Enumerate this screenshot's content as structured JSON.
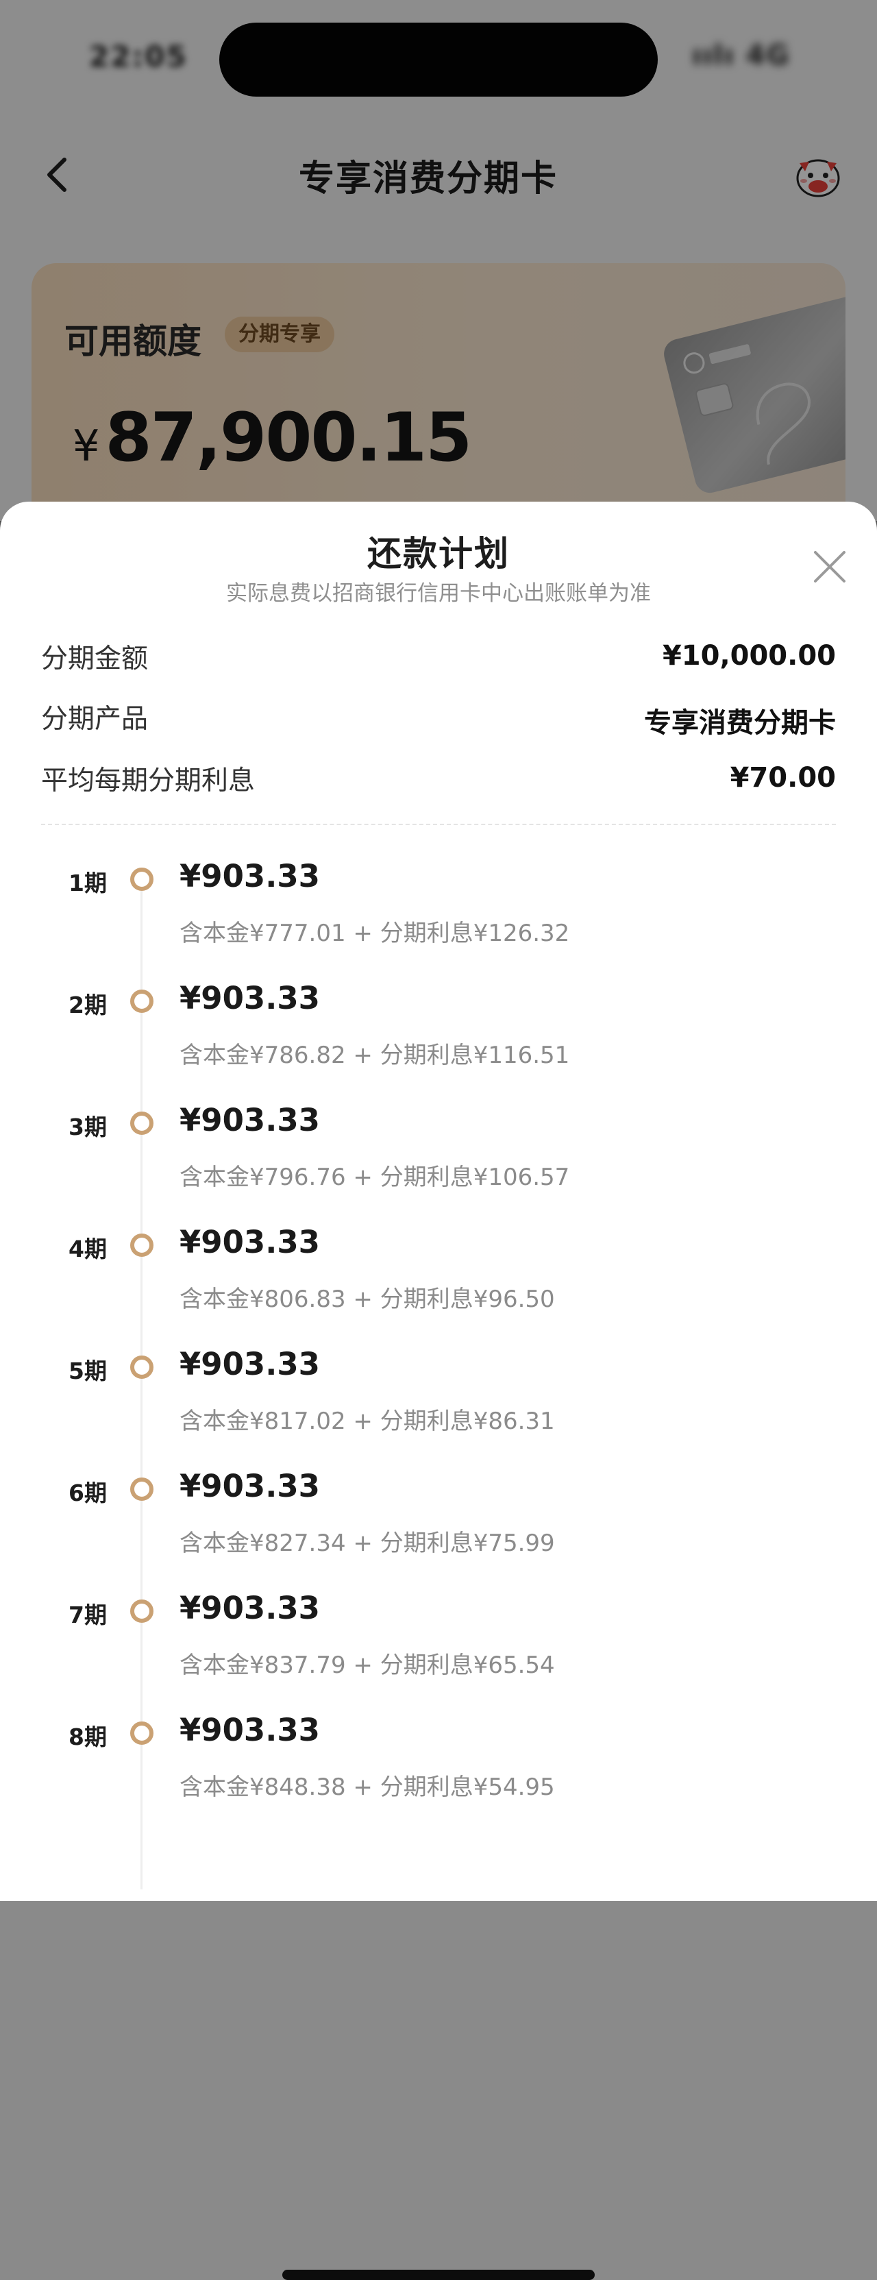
{
  "status_bar": {
    "time": "22:05",
    "right": "ıılı 4G"
  },
  "nav": {
    "title": "专享消费分期卡"
  },
  "card": {
    "available_label": "可用额度",
    "badge": "分期专享",
    "currency": "¥",
    "amount": "87,900.15"
  },
  "sheet": {
    "title": "还款计划",
    "subtitle": "实际息费以招商银行信用卡中心出账账单为准",
    "summary": [
      {
        "label": "分期金额",
        "value": "¥10,000.00"
      },
      {
        "label": "分期产品",
        "value": "专享消费分期卡"
      },
      {
        "label": "平均每期分期利息",
        "value": "¥70.00"
      }
    ],
    "plan": [
      {
        "period": "1期",
        "amount": "¥903.33",
        "detail": "含本金¥777.01 + 分期利息¥126.32"
      },
      {
        "period": "2期",
        "amount": "¥903.33",
        "detail": "含本金¥786.82 + 分期利息¥116.51"
      },
      {
        "period": "3期",
        "amount": "¥903.33",
        "detail": "含本金¥796.76 + 分期利息¥106.57"
      },
      {
        "period": "4期",
        "amount": "¥903.33",
        "detail": "含本金¥806.83 + 分期利息¥96.50"
      },
      {
        "period": "5期",
        "amount": "¥903.33",
        "detail": "含本金¥817.02 + 分期利息¥86.31"
      },
      {
        "period": "6期",
        "amount": "¥903.33",
        "detail": "含本金¥827.34 + 分期利息¥75.99"
      },
      {
        "period": "7期",
        "amount": "¥903.33",
        "detail": "含本金¥837.79 + 分期利息¥65.54"
      },
      {
        "period": "8期",
        "amount": "¥903.33",
        "detail": "含本金¥848.38 + 分期利息¥54.95"
      }
    ]
  },
  "colors": {
    "accent": "#caa173",
    "badge_bg": "#ecc99d",
    "card_gradient_start": "#f7dcbd"
  },
  "icons": {
    "back": "chevron-left-icon",
    "mascot": "cow-mascot-icon",
    "close": "close-icon",
    "card": "bank-card-image"
  }
}
